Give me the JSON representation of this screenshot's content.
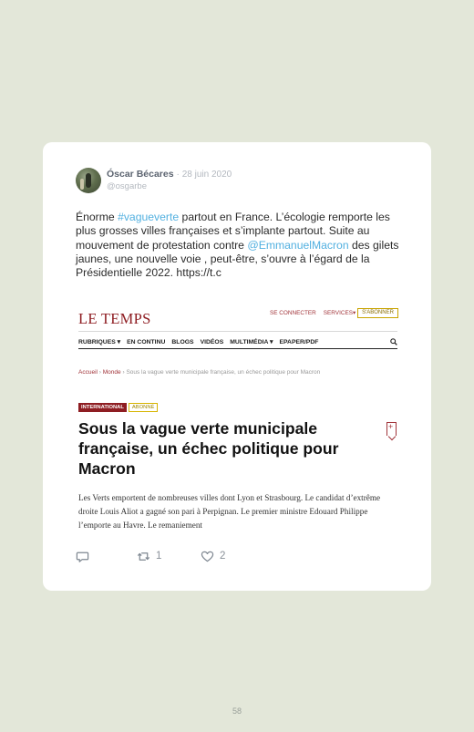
{
  "tweet": {
    "author_name": "Óscar Bécares",
    "separator": "·",
    "date": "28 juin 2020",
    "handle": "@osgarbe",
    "text_parts": {
      "p1": "Énorme ",
      "hashtag": "#vagueverte",
      "p2": " partout en France. L’écologie remporte les plus grosses villes françaises et s’implante partout. Suite au mouvement de protestation contre ",
      "mention": "@EmmanuelMacron",
      "p3": " des gilets jaunes, une nouvelle voie , peut-être, s’ouvre à l’égard de la Présidentielle 2022. https://t.c"
    },
    "actions": {
      "reply_icon": "speech-bubble-icon",
      "retweet_icon": "retweet-icon",
      "retweet_count": "1",
      "like_icon": "heart-icon",
      "like_count": "2"
    }
  },
  "embed": {
    "logo": "LE TEMPS",
    "top_links": [
      "SE CONNECTER",
      "SERVICES▾"
    ],
    "subscribe": "S'ABONNER",
    "nav": [
      "RUBRIQUES ▾",
      "EN CONTINU",
      "BLOGS",
      "VIDÉOS",
      "MULTIMÉDIA ▾",
      "EPAPER/PDF"
    ],
    "breadcrumb": {
      "home": "Accueil",
      "sep": "›",
      "section": "Monde",
      "current": "Sous la vague verte municipale française, un échec politique pour Macron"
    },
    "badges": {
      "section": "INTERNATIONAL",
      "subscriber": "ABONNÉ"
    },
    "headline": "Sous la vague verte municipale française, un échec politique pour Macron",
    "lede": "Les Verts emportent de nombreuses villes dont Lyon et Strasbourg. Le candidat d’extrême droite Louis Aliot a gagné son pari à Perpignan. Le premier ministre Edouard Philippe l’emporte au Havre. Le remaniement"
  },
  "page_number": "58",
  "colors": {
    "background": "#e3e7d9",
    "link": "#52b0e0",
    "letemps_red": "#8e1d22"
  }
}
